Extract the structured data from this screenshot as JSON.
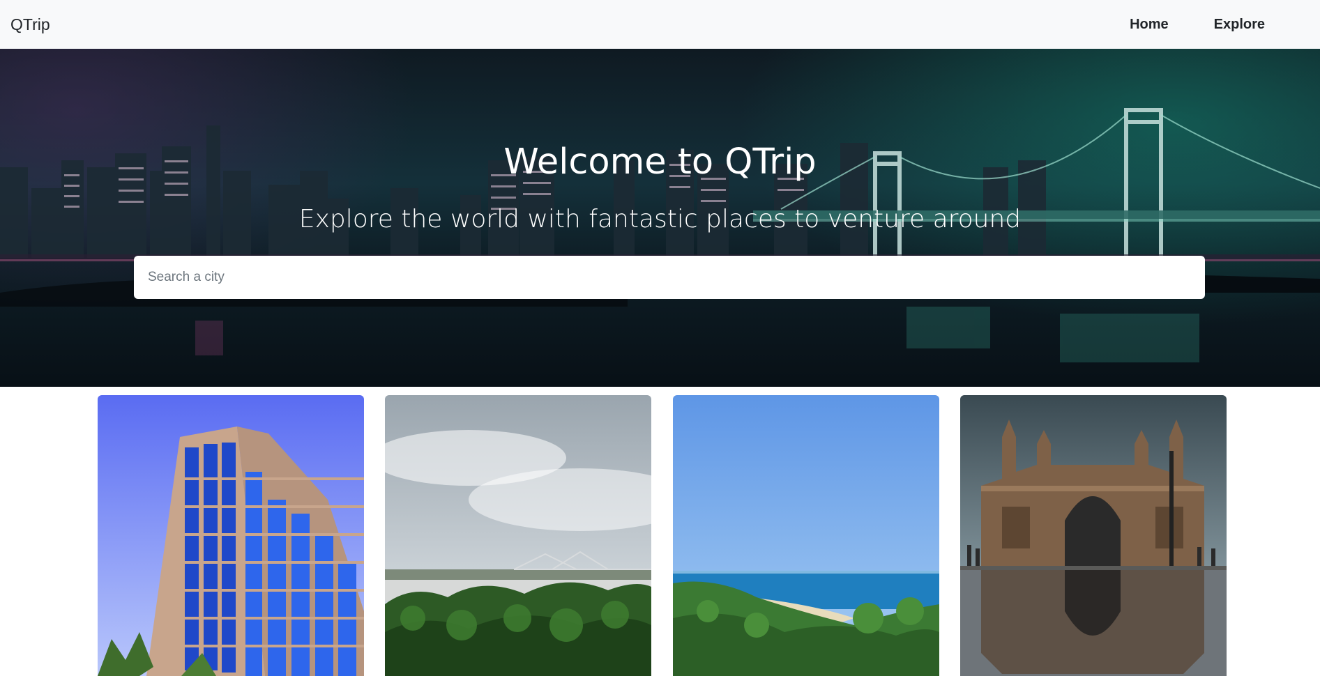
{
  "navbar": {
    "brand": "QTrip",
    "links": [
      {
        "label": "Home"
      },
      {
        "label": "Explore"
      }
    ]
  },
  "hero": {
    "title": "Welcome to QTrip",
    "subtitle": "Explore the world with fantastic places to venture around",
    "search": {
      "placeholder": "Search a city",
      "value": ""
    }
  },
  "cards": [
    {
      "image": "city-tower-image"
    },
    {
      "image": "river-bridge-image"
    },
    {
      "image": "beach-coast-image"
    },
    {
      "image": "gateway-monument-image"
    }
  ],
  "colors": {
    "navbar_bg": "#f8f9fa",
    "hero_overlay": "#14303a",
    "text_dark": "#212529"
  }
}
